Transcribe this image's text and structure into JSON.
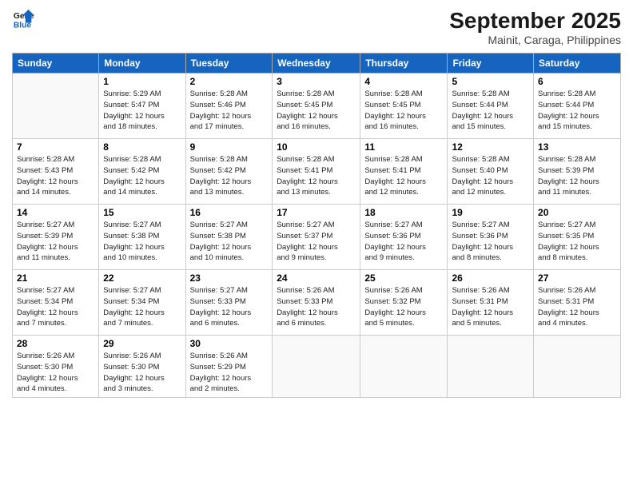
{
  "logo": {
    "line1": "General",
    "line2": "Blue"
  },
  "title": "September 2025",
  "subtitle": "Mainit, Caraga, Philippines",
  "days_of_week": [
    "Sunday",
    "Monday",
    "Tuesday",
    "Wednesday",
    "Thursday",
    "Friday",
    "Saturday"
  ],
  "weeks": [
    [
      {
        "num": "",
        "info": ""
      },
      {
        "num": "1",
        "info": "Sunrise: 5:29 AM\nSunset: 5:47 PM\nDaylight: 12 hours\nand 18 minutes."
      },
      {
        "num": "2",
        "info": "Sunrise: 5:28 AM\nSunset: 5:46 PM\nDaylight: 12 hours\nand 17 minutes."
      },
      {
        "num": "3",
        "info": "Sunrise: 5:28 AM\nSunset: 5:45 PM\nDaylight: 12 hours\nand 16 minutes."
      },
      {
        "num": "4",
        "info": "Sunrise: 5:28 AM\nSunset: 5:45 PM\nDaylight: 12 hours\nand 16 minutes."
      },
      {
        "num": "5",
        "info": "Sunrise: 5:28 AM\nSunset: 5:44 PM\nDaylight: 12 hours\nand 15 minutes."
      },
      {
        "num": "6",
        "info": "Sunrise: 5:28 AM\nSunset: 5:44 PM\nDaylight: 12 hours\nand 15 minutes."
      }
    ],
    [
      {
        "num": "7",
        "info": "Sunrise: 5:28 AM\nSunset: 5:43 PM\nDaylight: 12 hours\nand 14 minutes."
      },
      {
        "num": "8",
        "info": "Sunrise: 5:28 AM\nSunset: 5:42 PM\nDaylight: 12 hours\nand 14 minutes."
      },
      {
        "num": "9",
        "info": "Sunrise: 5:28 AM\nSunset: 5:42 PM\nDaylight: 12 hours\nand 13 minutes."
      },
      {
        "num": "10",
        "info": "Sunrise: 5:28 AM\nSunset: 5:41 PM\nDaylight: 12 hours\nand 13 minutes."
      },
      {
        "num": "11",
        "info": "Sunrise: 5:28 AM\nSunset: 5:41 PM\nDaylight: 12 hours\nand 12 minutes."
      },
      {
        "num": "12",
        "info": "Sunrise: 5:28 AM\nSunset: 5:40 PM\nDaylight: 12 hours\nand 12 minutes."
      },
      {
        "num": "13",
        "info": "Sunrise: 5:28 AM\nSunset: 5:39 PM\nDaylight: 12 hours\nand 11 minutes."
      }
    ],
    [
      {
        "num": "14",
        "info": "Sunrise: 5:27 AM\nSunset: 5:39 PM\nDaylight: 12 hours\nand 11 minutes."
      },
      {
        "num": "15",
        "info": "Sunrise: 5:27 AM\nSunset: 5:38 PM\nDaylight: 12 hours\nand 10 minutes."
      },
      {
        "num": "16",
        "info": "Sunrise: 5:27 AM\nSunset: 5:38 PM\nDaylight: 12 hours\nand 10 minutes."
      },
      {
        "num": "17",
        "info": "Sunrise: 5:27 AM\nSunset: 5:37 PM\nDaylight: 12 hours\nand 9 minutes."
      },
      {
        "num": "18",
        "info": "Sunrise: 5:27 AM\nSunset: 5:36 PM\nDaylight: 12 hours\nand 9 minutes."
      },
      {
        "num": "19",
        "info": "Sunrise: 5:27 AM\nSunset: 5:36 PM\nDaylight: 12 hours\nand 8 minutes."
      },
      {
        "num": "20",
        "info": "Sunrise: 5:27 AM\nSunset: 5:35 PM\nDaylight: 12 hours\nand 8 minutes."
      }
    ],
    [
      {
        "num": "21",
        "info": "Sunrise: 5:27 AM\nSunset: 5:34 PM\nDaylight: 12 hours\nand 7 minutes."
      },
      {
        "num": "22",
        "info": "Sunrise: 5:27 AM\nSunset: 5:34 PM\nDaylight: 12 hours\nand 7 minutes."
      },
      {
        "num": "23",
        "info": "Sunrise: 5:27 AM\nSunset: 5:33 PM\nDaylight: 12 hours\nand 6 minutes."
      },
      {
        "num": "24",
        "info": "Sunrise: 5:26 AM\nSunset: 5:33 PM\nDaylight: 12 hours\nand 6 minutes."
      },
      {
        "num": "25",
        "info": "Sunrise: 5:26 AM\nSunset: 5:32 PM\nDaylight: 12 hours\nand 5 minutes."
      },
      {
        "num": "26",
        "info": "Sunrise: 5:26 AM\nSunset: 5:31 PM\nDaylight: 12 hours\nand 5 minutes."
      },
      {
        "num": "27",
        "info": "Sunrise: 5:26 AM\nSunset: 5:31 PM\nDaylight: 12 hours\nand 4 minutes."
      }
    ],
    [
      {
        "num": "28",
        "info": "Sunrise: 5:26 AM\nSunset: 5:30 PM\nDaylight: 12 hours\nand 4 minutes."
      },
      {
        "num": "29",
        "info": "Sunrise: 5:26 AM\nSunset: 5:30 PM\nDaylight: 12 hours\nand 3 minutes."
      },
      {
        "num": "30",
        "info": "Sunrise: 5:26 AM\nSunset: 5:29 PM\nDaylight: 12 hours\nand 2 minutes."
      },
      {
        "num": "",
        "info": ""
      },
      {
        "num": "",
        "info": ""
      },
      {
        "num": "",
        "info": ""
      },
      {
        "num": "",
        "info": ""
      }
    ]
  ]
}
